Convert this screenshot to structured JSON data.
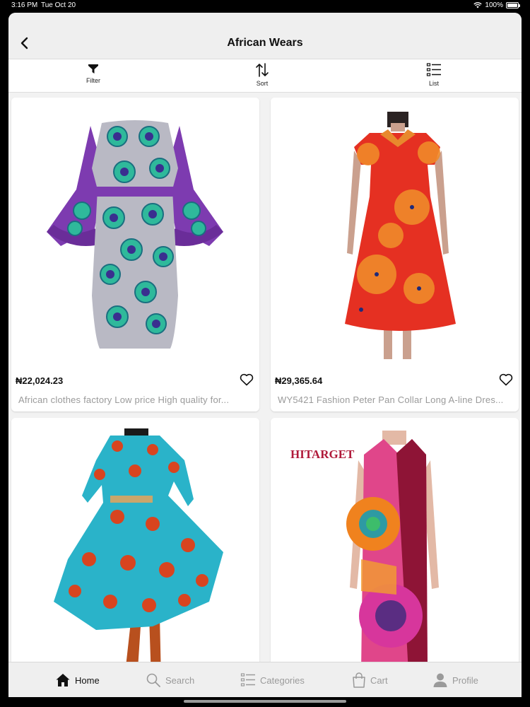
{
  "status": {
    "time": "3:16 PM",
    "date": "Tue Oct 20",
    "battery": "100%"
  },
  "nav": {
    "title": "African Wears"
  },
  "toolbar": {
    "filter_label": "Filter",
    "sort_label": "Sort",
    "list_label": "List"
  },
  "products": [
    {
      "price": "₦22,024.23",
      "name": "African clothes factory Low price High quality for..."
    },
    {
      "price": "₦29,365.64",
      "name": "WY5421 Fashion Peter Pan Collar Long A-line Dres..."
    },
    {
      "brand_watermark": "HITARGET"
    }
  ],
  "tabbar": {
    "home": "Home",
    "search": "Search",
    "categories": "Categories",
    "cart": "Cart",
    "profile": "Profile"
  },
  "colors": {
    "accent": "#111111",
    "inactive": "#9a9a9a",
    "price": "#111111"
  }
}
